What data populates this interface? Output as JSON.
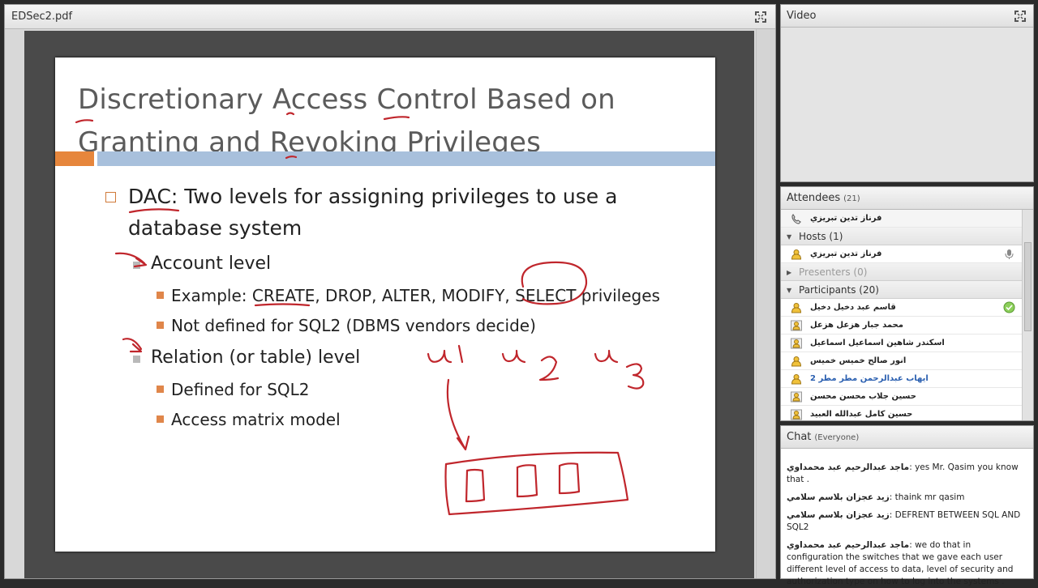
{
  "document_pod": {
    "title": "EDSec2.pdf",
    "slide": {
      "title_line1": "Discretionary Access Control Based on",
      "title_line2": "Granting and Revoking Privileges",
      "bullet_dac_1": "DAC: Two levels for assigning privileges to use a",
      "bullet_dac_2": "database system",
      "account_level": "Account level",
      "example": "Example: CREATE, DROP, ALTER, MODIFY, SELECT privileges",
      "not_defined": "Not defined for SQL2 (DBMS vendors decide)",
      "relation_level": "Relation (or table) level",
      "defined_for": "Defined for SQL2",
      "access_matrix": "Access matrix model"
    }
  },
  "video_pod": {
    "title": "Video"
  },
  "attendees_pod": {
    "title": "Attendees",
    "count": "(21)",
    "caller_name": "فرناز تدين تبريزي",
    "hosts_label": "Hosts (1)",
    "host_name": "فرناز تدين تبريزي",
    "presenters_label": "Presenters (0)",
    "participants_label": "Participants (20)",
    "participants": [
      {
        "name": "قاسم عبد دخيل دخيل",
        "highlight": false
      },
      {
        "name": "محمد جبار هزعل هزعل",
        "highlight": false
      },
      {
        "name": "اسكندر شاهين اسماعيل اسماعيل",
        "highlight": false
      },
      {
        "name": "انور صالح خميس خميس",
        "highlight": false
      },
      {
        "name": "ايهاب عبدالرحمن مطر مطر 2",
        "highlight": true
      },
      {
        "name": "حسين جلاب محسن محسن",
        "highlight": false
      },
      {
        "name": "حسين كامل عبدالله العبيد",
        "highlight": false
      }
    ]
  },
  "chat_pod": {
    "title": "Chat",
    "scope": "(Everyone)",
    "messages": [
      {
        "who": "ماجد عبدالرحيم عبد محمداوي",
        "text": " yes Mr. Qasim you know that ."
      },
      {
        "who": "زيد عجزان بلاسم سلامي",
        "text": " thaink mr qasim"
      },
      {
        "who": "زيد عجزان بلاسم سلامي",
        "text": " DEFRENT BETWEEN SQL AND SQL2"
      },
      {
        "who": "ماجد عبدالرحيم عبد محمداوي",
        "text": " we do that in configuration the switches that we gave each user different level of access to data, level of security and authorization type on how to log into the systems ."
      }
    ]
  },
  "colors": {
    "slide_title": "#5b5b5b",
    "accent_orange": "#e6863c",
    "accent_blue": "#a8c0dc",
    "ink_red": "#c0262c",
    "participant_highlight": "#2a5fb0"
  },
  "annotations": {
    "u1": "u1",
    "u2": "u2",
    "u3": "u3"
  }
}
